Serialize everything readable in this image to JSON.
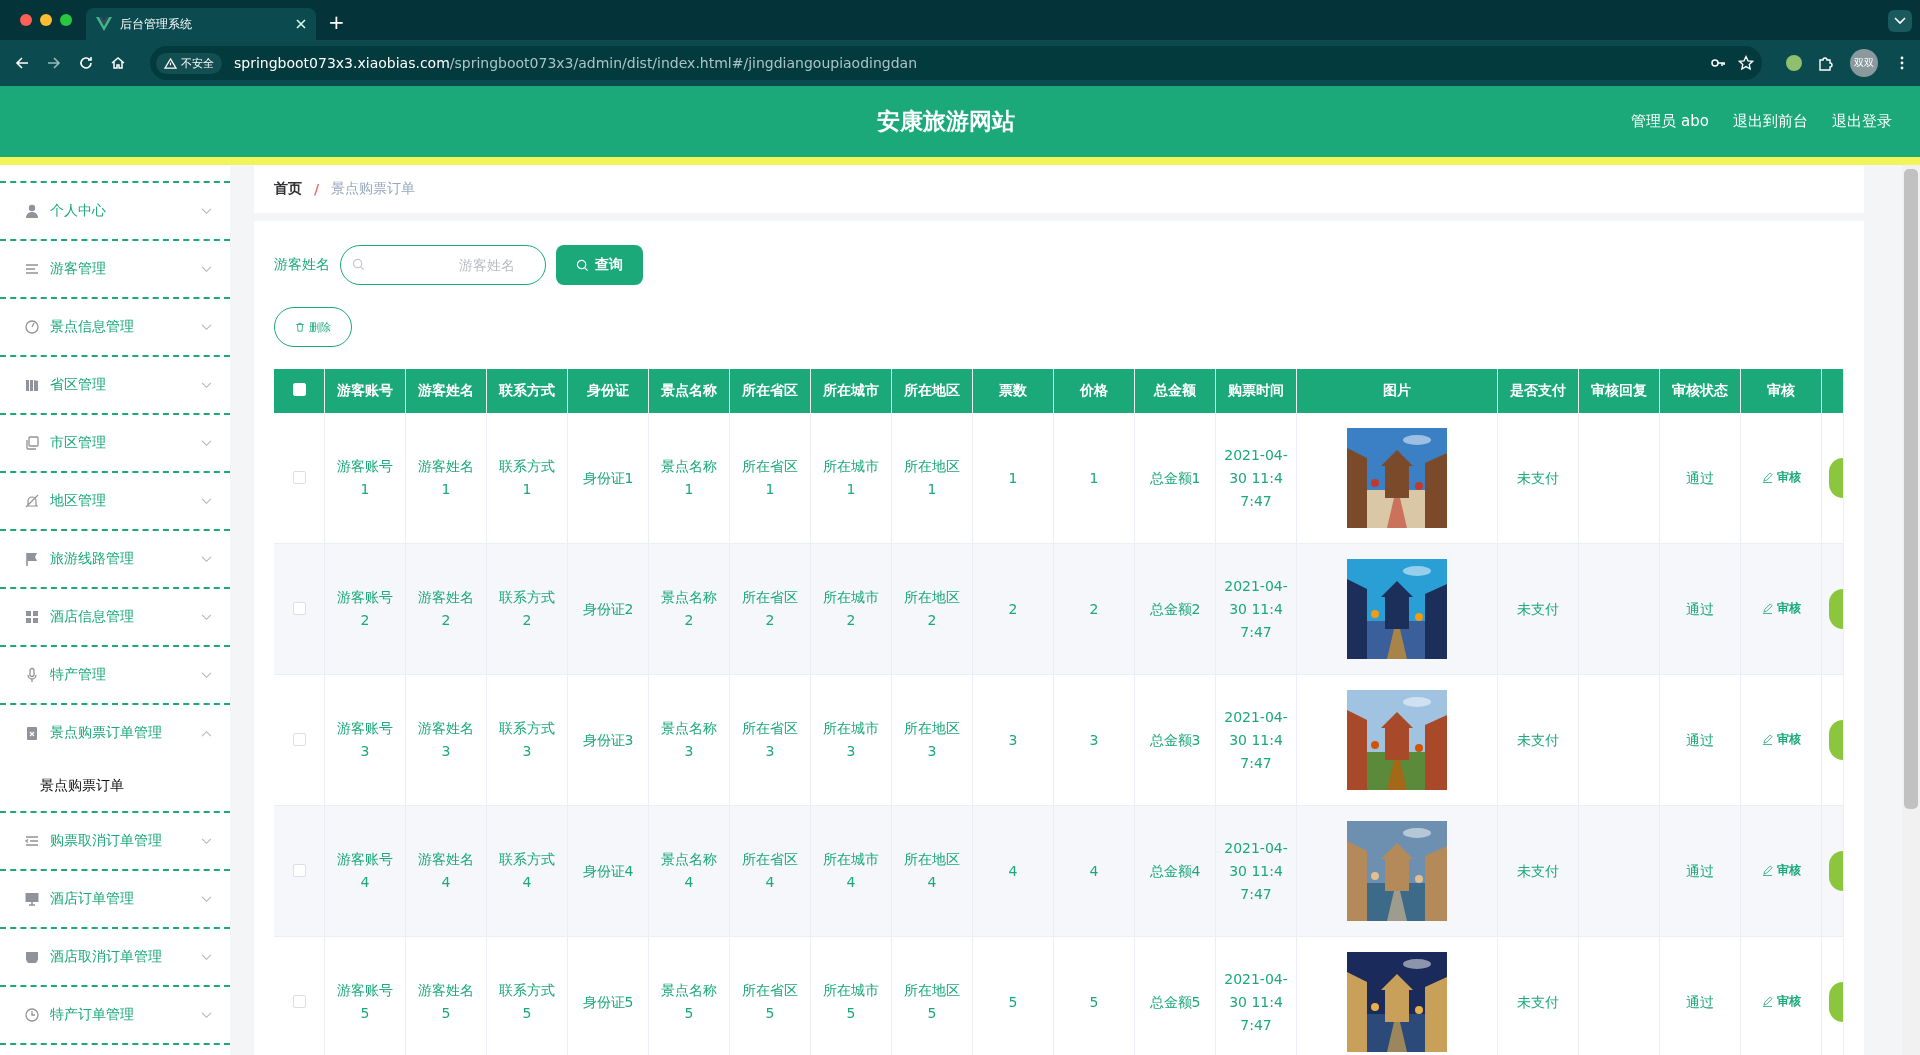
{
  "browser": {
    "tab_title": "后台管理系统",
    "new_tab": "+",
    "security": "不安全",
    "url_host": "springboot073x3.xiaobias.com",
    "url_path": "/springboot073x3/admin/dist/index.html#/jingdiangoupiaodingdan",
    "profile": "双双"
  },
  "header": {
    "title": "安康旅游网站",
    "links": [
      "管理员 abo",
      "退出到前台",
      "退出登录"
    ]
  },
  "sidebar": {
    "items": [
      {
        "label": "个人中心",
        "expanded": false
      },
      {
        "label": "游客管理",
        "expanded": false
      },
      {
        "label": "景点信息管理",
        "expanded": false
      },
      {
        "label": "省区管理",
        "expanded": false
      },
      {
        "label": "市区管理",
        "expanded": false
      },
      {
        "label": "地区管理",
        "expanded": false
      },
      {
        "label": "旅游线路管理",
        "expanded": false
      },
      {
        "label": "酒店信息管理",
        "expanded": false
      },
      {
        "label": "特产管理",
        "expanded": false
      },
      {
        "label": "景点购票订单管理",
        "expanded": true,
        "children": [
          {
            "label": "景点购票订单",
            "selected": true
          }
        ]
      },
      {
        "label": "购票取消订单管理",
        "expanded": false
      },
      {
        "label": "酒店订单管理",
        "expanded": false
      },
      {
        "label": "酒店取消订单管理",
        "expanded": false
      },
      {
        "label": "特产订单管理",
        "expanded": false
      }
    ]
  },
  "breadcrumb": {
    "items": [
      "首页",
      "景点购票订单"
    ],
    "separator": "/"
  },
  "search": {
    "label": "游客姓名",
    "placeholder": "游客姓名",
    "button": "查询"
  },
  "delete_button": "删除",
  "table": {
    "all_selected": false,
    "columns": [
      "游客账号",
      "游客姓名",
      "联系方式",
      "身份证",
      "景点名称",
      "所在省区",
      "所在城市",
      "所在地区",
      "票数",
      "价格",
      "总金额",
      "购票时间",
      "图片",
      "是否支付",
      "审核回复",
      "审核状态",
      "审核"
    ],
    "rows": [
      {
        "selected": false,
        "cells": [
          "游客账号1",
          "游客姓名1",
          "联系方式1",
          "身份证1",
          "景点名称1",
          "所在省区1",
          "所在城市1",
          "所在地区1",
          "1",
          "1",
          "总金额1",
          "2021-04-30 11:47:47"
        ],
        "paid": "未支付",
        "audit_status": "通过",
        "review": "审核"
      },
      {
        "selected": false,
        "cells": [
          "游客账号2",
          "游客姓名2",
          "联系方式2",
          "身份证2",
          "景点名称2",
          "所在省区2",
          "所在城市2",
          "所在地区2",
          "2",
          "2",
          "总金额2",
          "2021-04-30 11:47:47"
        ],
        "paid": "未支付",
        "audit_status": "通过",
        "review": "审核"
      },
      {
        "selected": false,
        "cells": [
          "游客账号3",
          "游客姓名3",
          "联系方式3",
          "身份证3",
          "景点名称3",
          "所在省区3",
          "所在城市3",
          "所在地区3",
          "3",
          "3",
          "总金额3",
          "2021-04-30 11:47:47"
        ],
        "paid": "未支付",
        "audit_status": "通过",
        "review": "审核"
      },
      {
        "selected": false,
        "cells": [
          "游客账号4",
          "游客姓名4",
          "联系方式4",
          "身份证4",
          "景点名称4",
          "所在省区4",
          "所在城市4",
          "所在地区4",
          "4",
          "4",
          "总金额4",
          "2021-04-30 11:47:47"
        ],
        "paid": "未支付",
        "audit_status": "通过",
        "review": "审核"
      },
      {
        "selected": false,
        "cells": [
          "游客账号5",
          "游客姓名5",
          "联系方式5",
          "身份证5",
          "景点名称5",
          "所在省区5",
          "所在城市5",
          "所在地区5",
          "5",
          "5",
          "总金额5",
          "2021-04-30 11:47:47"
        ],
        "paid": "未支付",
        "audit_status": "通过",
        "review": "审核"
      }
    ]
  }
}
